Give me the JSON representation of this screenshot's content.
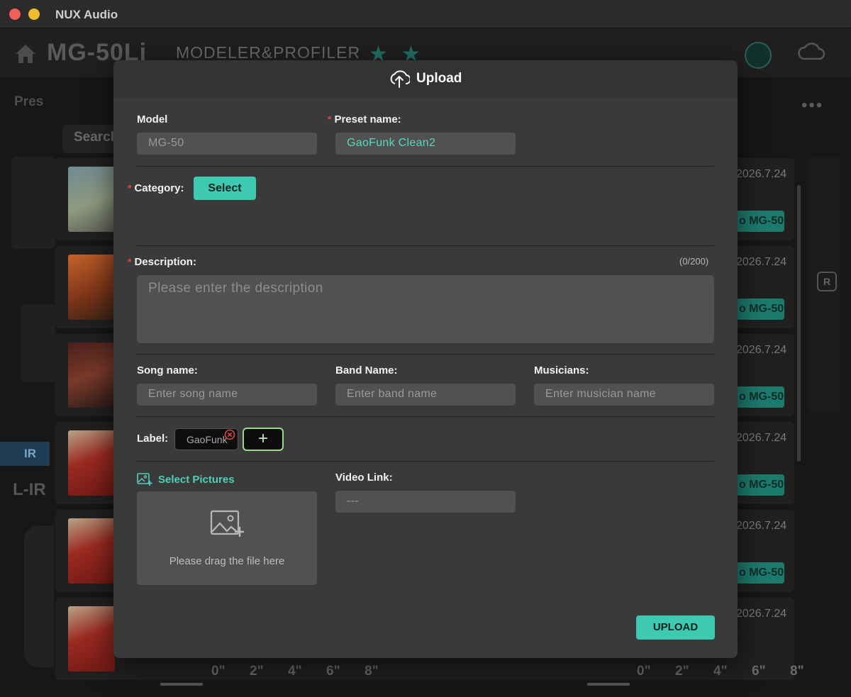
{
  "window": {
    "title": "NUX Audio"
  },
  "background": {
    "logo": "MG-50Li",
    "logo_sub": "MODELER&PROFILER",
    "left_label": "Pres",
    "search_tab": "Search",
    "ir_tab": "IR",
    "lir_label": "L-IR",
    "items": [
      {
        "date": "2026.7.24",
        "apply": "o MG-50"
      },
      {
        "date": "2026.7.24",
        "apply": "o MG-50"
      },
      {
        "date": "2026.7.24",
        "apply": "o MG-50"
      },
      {
        "date": "2026.7.24",
        "apply": "o MG-50"
      },
      {
        "date": "2026.7.24",
        "apply": "o MG-50"
      },
      {
        "date": "2026.7.24",
        "apply": ""
      }
    ],
    "ruler_left": [
      "0\"",
      "2\"",
      "4\"",
      "6\"",
      "8\""
    ],
    "ruler_right": [
      "0\"",
      "2\"",
      "4\"",
      "6\"",
      "8\""
    ]
  },
  "modal": {
    "title": "Upload",
    "model_label": "Model",
    "model_value": "MG-50",
    "preset_label": "Preset name:",
    "preset_value": "GaoFunk Clean2",
    "required_mark": "*",
    "category_label": "Category:",
    "category_button": "Select",
    "description_label": "Description:",
    "description_counter": "(0/200)",
    "description_placeholder": "Please enter the description",
    "song_label": "Song name:",
    "song_placeholder": "Enter song name",
    "band_label": "Band Name:",
    "band_placeholder": "Enter band name",
    "musician_label": "Musicians:",
    "musician_placeholder": "Enter musician name",
    "label_label": "Label:",
    "tags": [
      "GaoFunk"
    ],
    "add_tag": "+",
    "select_pictures": "Select Pictures",
    "drop_text": "Please drag the file here",
    "video_label": "Video Link:",
    "video_placeholder": "---",
    "upload_button": "UPLOAD"
  },
  "colors": {
    "accent": "#3ecab0",
    "required": "#e2473f",
    "modal_bg": "#3a3a3a",
    "input_bg": "#515151"
  },
  "icons": {
    "title_icon": "cloud-upload-icon",
    "pictures_icon": "image-add-icon",
    "dropzone_icon": "image-add-icon",
    "tag_remove_icon": "close-circle-icon"
  }
}
